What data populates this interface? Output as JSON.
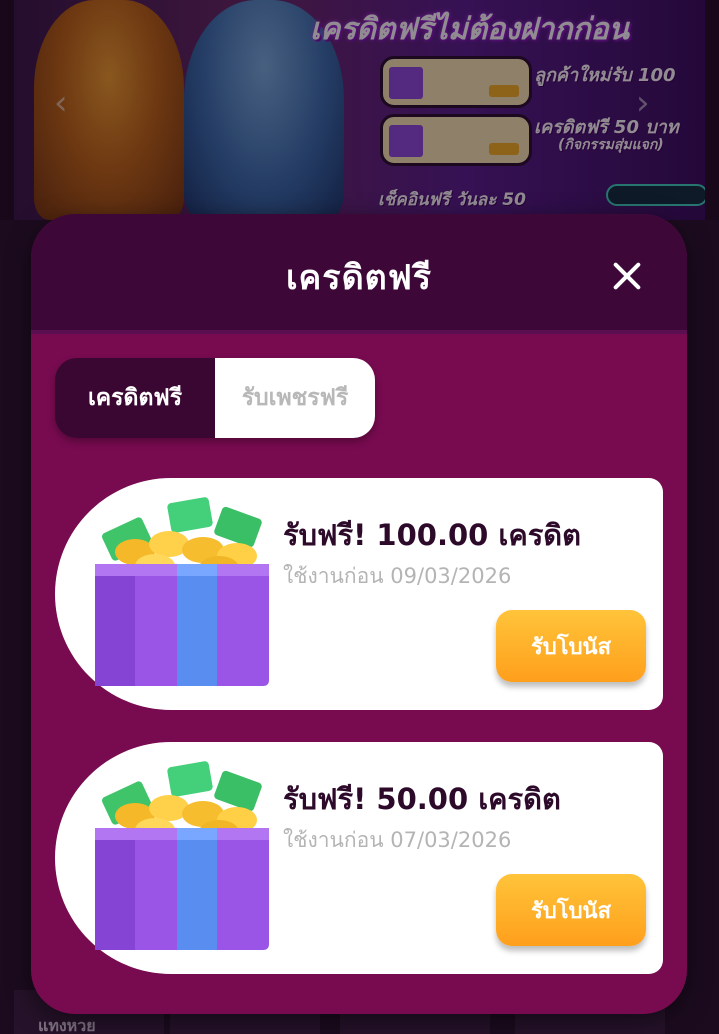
{
  "background": {
    "banner_title": "เครดิตฟรีไม่ต้องฝากก่อน",
    "banner_rows": [
      "ลูกค้าใหม่รับ 100",
      "เครดิตฟรี 50 บาท",
      "(กิจกรรมสุ่มแจก)"
    ],
    "banner_checkin": "เช็คอินฟรี วันละ 50",
    "tile_label": "แทงหวย"
  },
  "modal": {
    "title": "เครดิตฟรี",
    "tabs": [
      {
        "label": "เครดิตฟรี",
        "active": true
      },
      {
        "label": "รับเพชรฟรี",
        "active": false
      }
    ],
    "bonuses": [
      {
        "title": "รับฟรี! 100.00 เครดิต",
        "expiry": "ใช้งานก่อน 09/03/2026",
        "button": "รับโบนัส"
      },
      {
        "title": "รับฟรี! 50.00 เครดิต",
        "expiry": "ใช้งานก่อน 07/03/2026",
        "button": "รับโบนัส"
      }
    ]
  },
  "icons": {
    "close": "close-icon",
    "gift": "gift-box-icon",
    "carousel_prev": "chevron-left-icon",
    "carousel_next": "chevron-right-icon"
  },
  "colors": {
    "modal_body": "#780b50",
    "modal_header": "#3d0838",
    "tab_active": "#3a0733",
    "claim_button": "#ffaa22",
    "title_text": "#2d0a2a",
    "expiry_text": "#b4b4b4"
  }
}
